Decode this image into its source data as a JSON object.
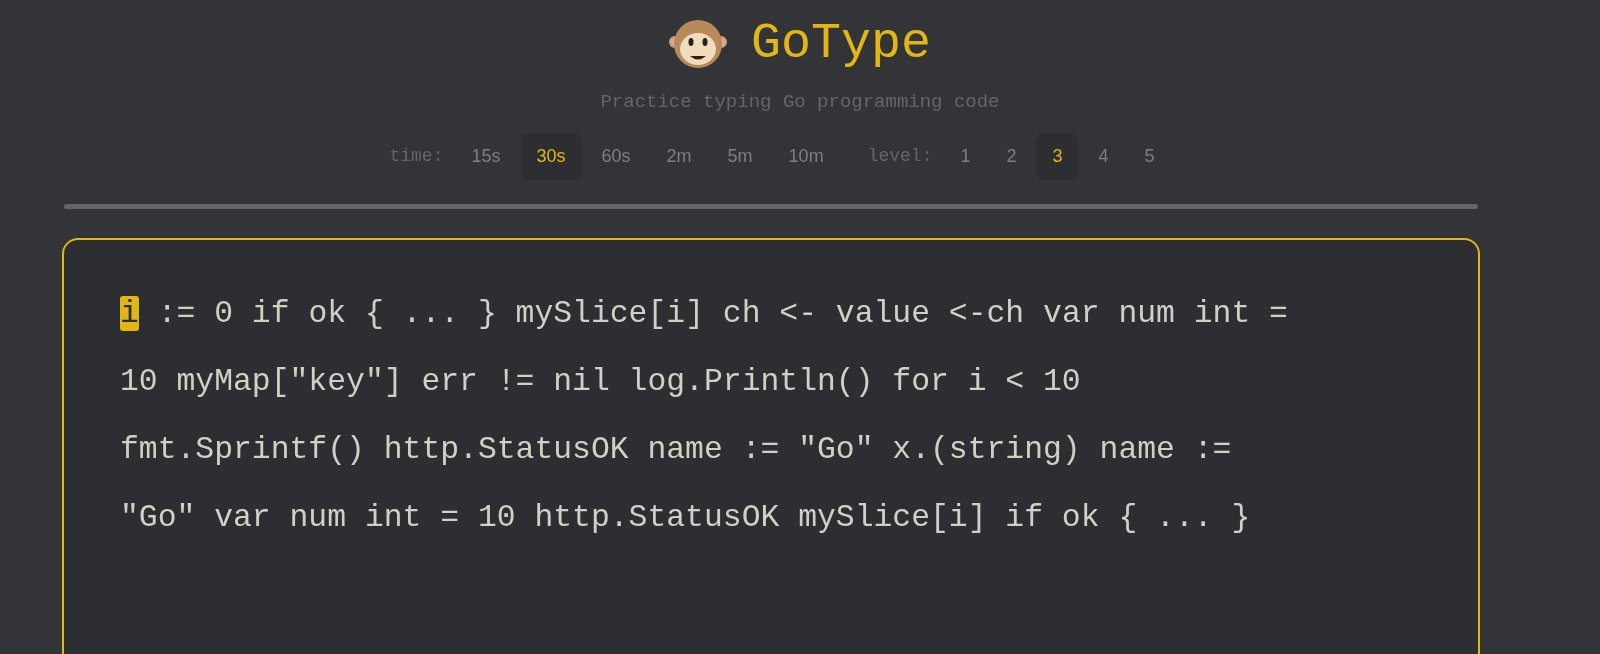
{
  "header": {
    "title": "GoType",
    "subtitle": "Practice typing Go programming code"
  },
  "time": {
    "label": "time:",
    "options": [
      {
        "label": "15s",
        "selected": false
      },
      {
        "label": "30s",
        "selected": true
      },
      {
        "label": "60s",
        "selected": false
      },
      {
        "label": "2m",
        "selected": false
      },
      {
        "label": "5m",
        "selected": false
      },
      {
        "label": "10m",
        "selected": false
      }
    ]
  },
  "level": {
    "label": "level:",
    "options": [
      {
        "label": "1",
        "selected": false
      },
      {
        "label": "2",
        "selected": false
      },
      {
        "label": "3",
        "selected": true
      },
      {
        "label": "4",
        "selected": false
      },
      {
        "label": "5",
        "selected": false
      }
    ]
  },
  "code": {
    "current_char": "i",
    "lines": [
      " := 0 if ok { ... } mySlice[i] ch <- value <-ch var num int =",
      "10 myMap[\"key\"] err != nil log.Println() for i < 10",
      "fmt.Sprintf() http.StatusOK name := \"Go\" x.(string) name :=",
      "\"Go\" var num int = 10 http.StatusOK mySlice[i] if ok { ... }"
    ]
  }
}
